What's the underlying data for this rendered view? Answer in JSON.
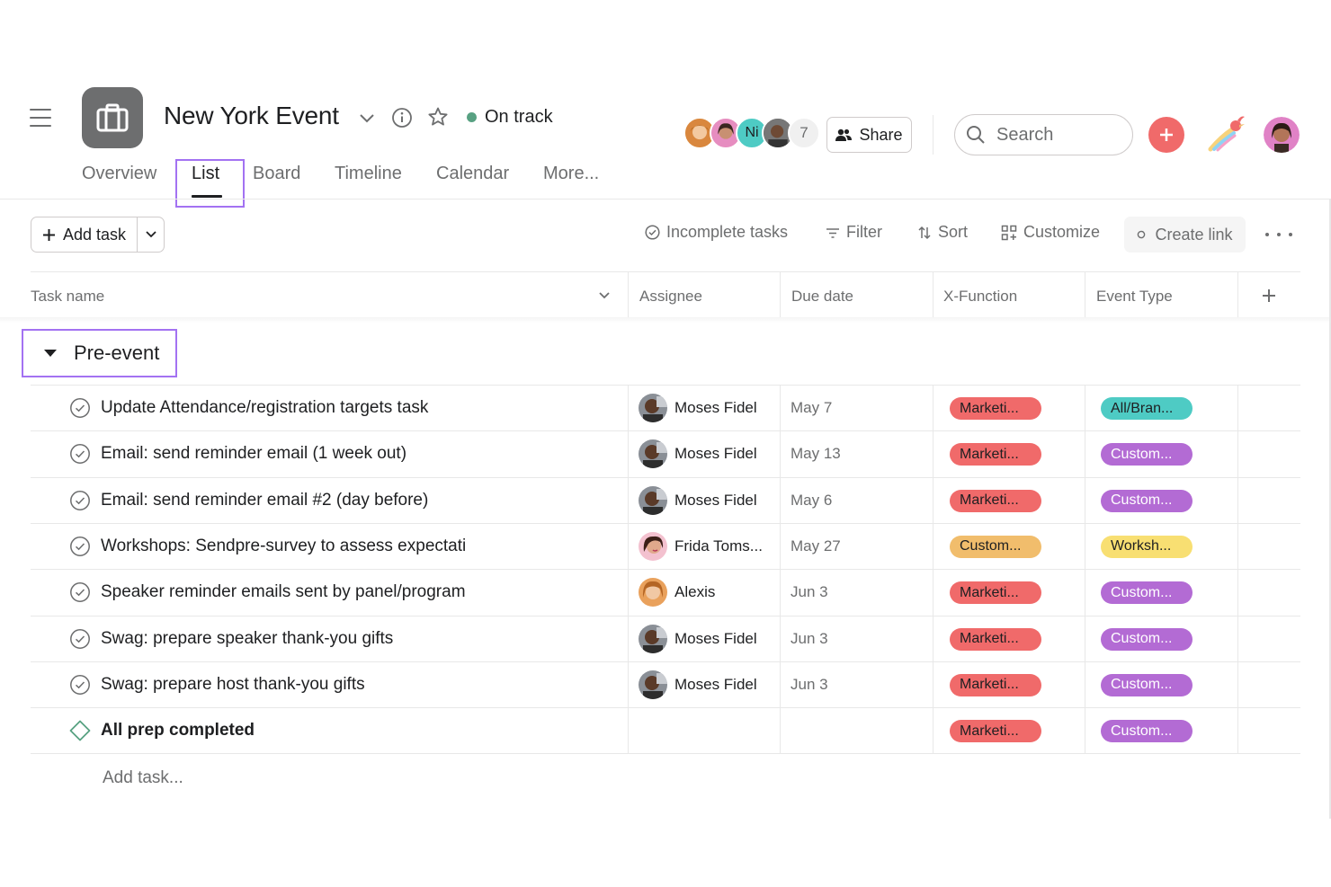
{
  "project": {
    "title": "New York Event",
    "status_label": "On track",
    "status_color": "#58a182",
    "icon": "briefcase-icon"
  },
  "members": {
    "initials": "Ni",
    "extra_count": "7"
  },
  "header": {
    "share_label": "Share",
    "search_placeholder": "Search"
  },
  "tabs": [
    {
      "label": "Overview"
    },
    {
      "label": "List",
      "active": true
    },
    {
      "label": "Board"
    },
    {
      "label": "Timeline"
    },
    {
      "label": "Calendar"
    },
    {
      "label": "More..."
    }
  ],
  "toolbar": {
    "add_task": "Add task",
    "incomplete": "Incomplete tasks",
    "filter": "Filter",
    "sort": "Sort",
    "customize": "Customize",
    "create_link": "Create link"
  },
  "columns": {
    "task_name": "Task name",
    "assignee": "Assignee",
    "due_date": "Due date",
    "x_function": "X-Function",
    "event_type": "Event Type"
  },
  "section": {
    "title": "Pre-event"
  },
  "colors": {
    "accent": "#f06a6a",
    "highlight": "#a372f2",
    "marketing": "#f06a6a",
    "custom_orange": "#f1bd6c",
    "all_brand": "#4ecbc4",
    "custom_purple": "#b36bd4",
    "workshop": "#f8df72"
  },
  "tasks": [
    {
      "name": "Update Attendance/registration targets task",
      "assignee": "Moses Fidel",
      "due": "May 7",
      "xfunction": "Marketi...",
      "eventtype": "All/Bran..."
    },
    {
      "name": "Email: send reminder email (1 week out)",
      "assignee": "Moses Fidel",
      "due": "May 13",
      "xfunction": "Marketi...",
      "eventtype": "Custom..."
    },
    {
      "name": "Email: send reminder email #2 (day before)",
      "assignee": "Moses Fidel",
      "due": "May 6",
      "xfunction": "Marketi...",
      "eventtype": "Custom..."
    },
    {
      "name": "Workshops: Sendpre-survey to assess expectati",
      "assignee": "Frida Toms...",
      "due": "May 27",
      "xfunction": "Custom...",
      "eventtype": "Worksh..."
    },
    {
      "name": "Speaker reminder emails sent by panel/program",
      "assignee": "Alexis",
      "due": "Jun 3",
      "xfunction": "Marketi...",
      "eventtype": "Custom..."
    },
    {
      "name": "Swag: prepare speaker thank-you gifts",
      "assignee": "Moses Fidel",
      "due": "Jun 3",
      "xfunction": "Marketi...",
      "eventtype": "Custom..."
    },
    {
      "name": "Swag: prepare host thank-you gifts",
      "assignee": "Moses Fidel",
      "due": "Jun 3",
      "xfunction": "Marketi...",
      "eventtype": "Custom..."
    },
    {
      "name": "All prep completed",
      "assignee": "",
      "due": "",
      "xfunction": "Marketi...",
      "eventtype": "Custom...",
      "milestone": true
    }
  ],
  "add_task_inline": "Add task..."
}
